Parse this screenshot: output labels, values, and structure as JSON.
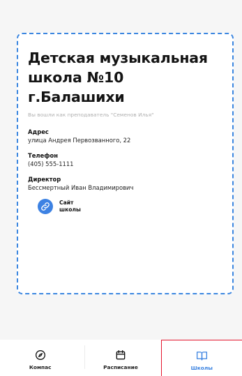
{
  "school": {
    "title": "Детская музыкальная школа №10 г.Балашихи",
    "login_note": "Вы вошли как преподаватель \"Семенов Илья\""
  },
  "info": [
    {
      "label": "Адрес",
      "value": "улица Андрея Первозванного, 22"
    },
    {
      "label": "Телефон",
      "value": "(405) 555-1111"
    },
    {
      "label": "Директор",
      "value": "Бессмертный Иван Владимирович"
    }
  ],
  "site_link": {
    "label": "Сайт\nшколы",
    "icon": "link-icon"
  },
  "nav": {
    "items": [
      {
        "label": "Компас",
        "icon": "compass-icon",
        "active": false
      },
      {
        "label": "Расписание",
        "icon": "calendar-icon",
        "active": false
      },
      {
        "label": "Школы",
        "icon": "book-icon",
        "active": true
      }
    ]
  },
  "colors": {
    "accent": "#3b86e0",
    "active_outline": "#e4142b",
    "background": "#f6f6f6"
  }
}
